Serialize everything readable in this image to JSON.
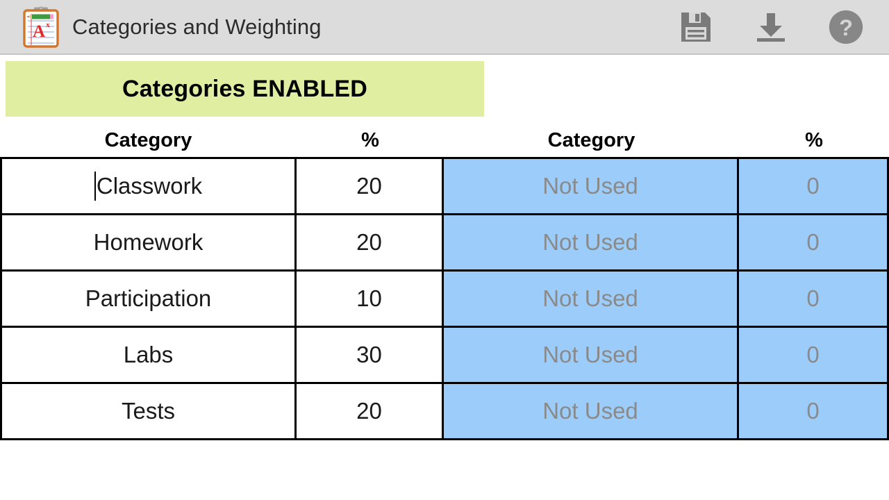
{
  "titlebar": {
    "app_icon_name": "clipboard-grade-icon",
    "title": "Categories and Weighting",
    "background_color": "#dcdcdc",
    "actions": [
      {
        "name": "save-button",
        "icon": "floppy-disk-icon",
        "label": "Save"
      },
      {
        "name": "download-button",
        "icon": "download-arrow-icon",
        "label": "Download"
      },
      {
        "name": "help-button",
        "icon": "question-circle-icon",
        "label": "Help"
      }
    ]
  },
  "status_banner": {
    "label": "Categories ENABLED",
    "background_color": "#dfeea1",
    "text_color": "#000000"
  },
  "table": {
    "headers": [
      "Category",
      "%",
      "Category",
      "%"
    ],
    "disabled_cell_color": "#9ccdfa",
    "disabled_text_color": "#8a8a8a",
    "rows": [
      {
        "category": "Classwork",
        "percent": "20",
        "category2": "Not Used",
        "percent2": "0",
        "editing": true
      },
      {
        "category": "Homework",
        "percent": "20",
        "category2": "Not Used",
        "percent2": "0",
        "editing": false
      },
      {
        "category": "Participation",
        "percent": "10",
        "category2": "Not Used",
        "percent2": "0",
        "editing": false
      },
      {
        "category": "Labs",
        "percent": "30",
        "category2": "Not Used",
        "percent2": "0",
        "editing": false
      },
      {
        "category": "Tests",
        "percent": "20",
        "category2": "Not Used",
        "percent2": "0",
        "editing": false
      }
    ]
  }
}
